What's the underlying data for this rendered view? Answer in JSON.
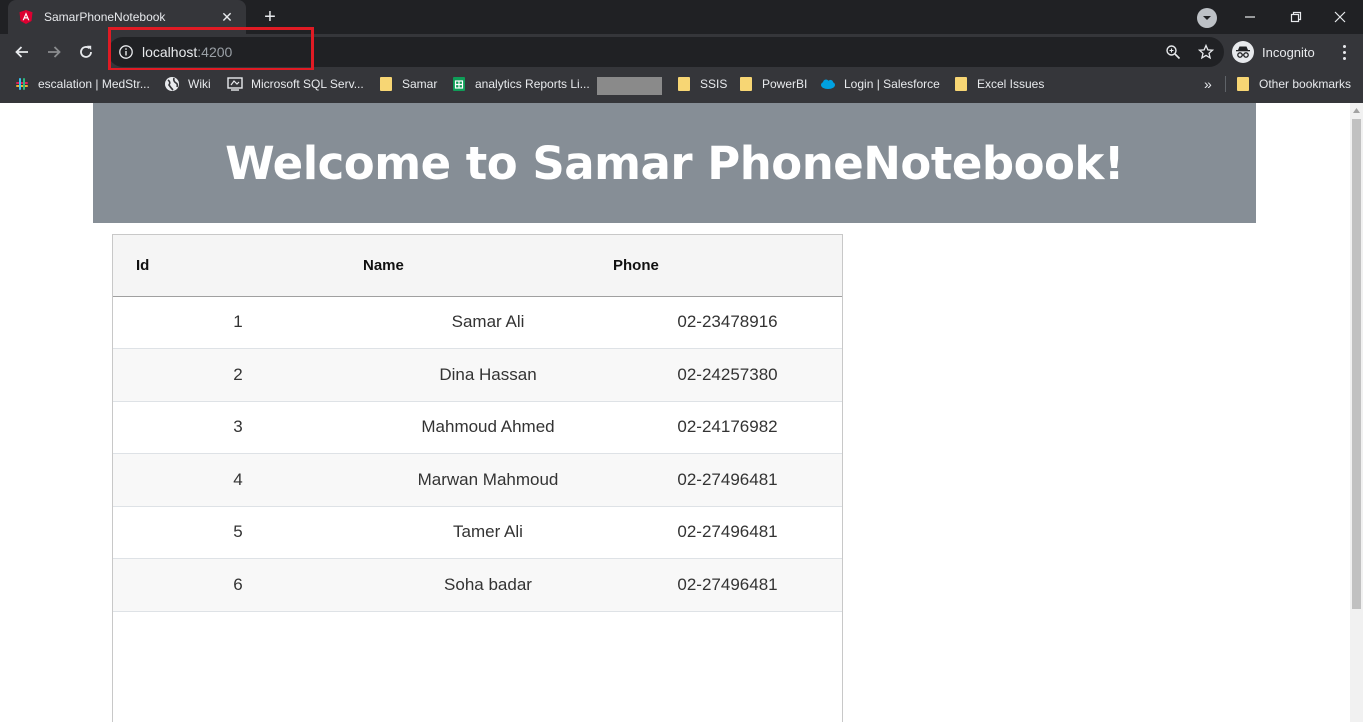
{
  "browser": {
    "tab_title": "SamarPhoneNotebook",
    "new_tab_label": "+",
    "url_host": "localhost",
    "url_port": ":4200",
    "profile_label": "Incognito",
    "overflow_label": "»",
    "accent_highlight": "#e01b24"
  },
  "bookmarks": [
    {
      "label": "escalation | MedStr...",
      "icon": "slack-icon"
    },
    {
      "label": "Wiki",
      "icon": "globe-icon"
    },
    {
      "label": "Microsoft SQL Serv...",
      "icon": "sql-server-icon"
    },
    {
      "label": "Samar",
      "icon": "folder-icon"
    },
    {
      "label": "analytics Reports Li...",
      "icon": "sheets-icon"
    },
    {
      "label": "SSIS",
      "icon": "folder-icon"
    },
    {
      "label": "PowerBI",
      "icon": "folder-icon"
    },
    {
      "label": "Login | Salesforce",
      "icon": "salesforce-icon"
    },
    {
      "label": "Excel Issues",
      "icon": "folder-icon"
    },
    {
      "label": "Other bookmarks",
      "icon": "folder-icon"
    }
  ],
  "page": {
    "heading": "Welcome to Samar PhoneNotebook!",
    "heading_bg": "#868e96"
  },
  "table": {
    "headers": [
      "Id",
      "Name",
      "Phone"
    ],
    "rows": [
      {
        "id": "1",
        "name": "Samar Ali",
        "phone": "02-23478916"
      },
      {
        "id": "2",
        "name": "Dina Hassan",
        "phone": "02-24257380"
      },
      {
        "id": "3",
        "name": "Mahmoud Ahmed",
        "phone": "02-24176982"
      },
      {
        "id": "4",
        "name": "Marwan Mahmoud",
        "phone": "02-27496481"
      },
      {
        "id": "5",
        "name": "Tamer Ali",
        "phone": "02-27496481"
      },
      {
        "id": "6",
        "name": "Soha badar",
        "phone": "02-27496481"
      }
    ]
  }
}
